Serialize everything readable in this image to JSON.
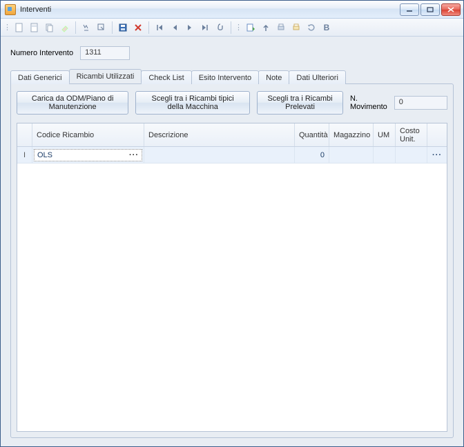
{
  "window": {
    "title": "Interventi"
  },
  "toolbar": {
    "icons": [
      "new",
      "open",
      "copy",
      "eraser",
      "find",
      "find-next",
      "save",
      "delete",
      "first",
      "prev",
      "next",
      "last",
      "attach",
      "refresh-doc",
      "up",
      "print",
      "print2",
      "sync",
      "bold"
    ]
  },
  "header": {
    "numero_label": "Numero Intervento",
    "numero_value": "1311"
  },
  "tabs": [
    {
      "id": "dati-generici",
      "label": "Dati Generici"
    },
    {
      "id": "ricambi-utilizzati",
      "label": "Ricambi Utilizzati",
      "active": true
    },
    {
      "id": "check-list",
      "label": "Check List"
    },
    {
      "id": "esito-intervento",
      "label": "Esito Intervento"
    },
    {
      "id": "note",
      "label": "Note"
    },
    {
      "id": "dati-ulteriori",
      "label": "Dati Ulteriori"
    }
  ],
  "actions": {
    "btn1": "Carica da ODM/Piano di Manutenzione",
    "btn2": "Scegli tra i Ricambi tipici della Macchina",
    "btn3": "Scegli tra i Ricambi Prelevati",
    "movimento_label": "N. Movimento",
    "movimento_value": "0"
  },
  "grid": {
    "columns": [
      "",
      "Codice Ricambio",
      "Descrizione",
      "Quantità",
      "Magazzino",
      "UM",
      "Costo Unit.",
      ""
    ],
    "rows": [
      {
        "indicator": "I",
        "codice": "OLS",
        "descrizione": "",
        "quantita": "0",
        "magazzino": "",
        "um": "",
        "costo": ""
      }
    ]
  }
}
